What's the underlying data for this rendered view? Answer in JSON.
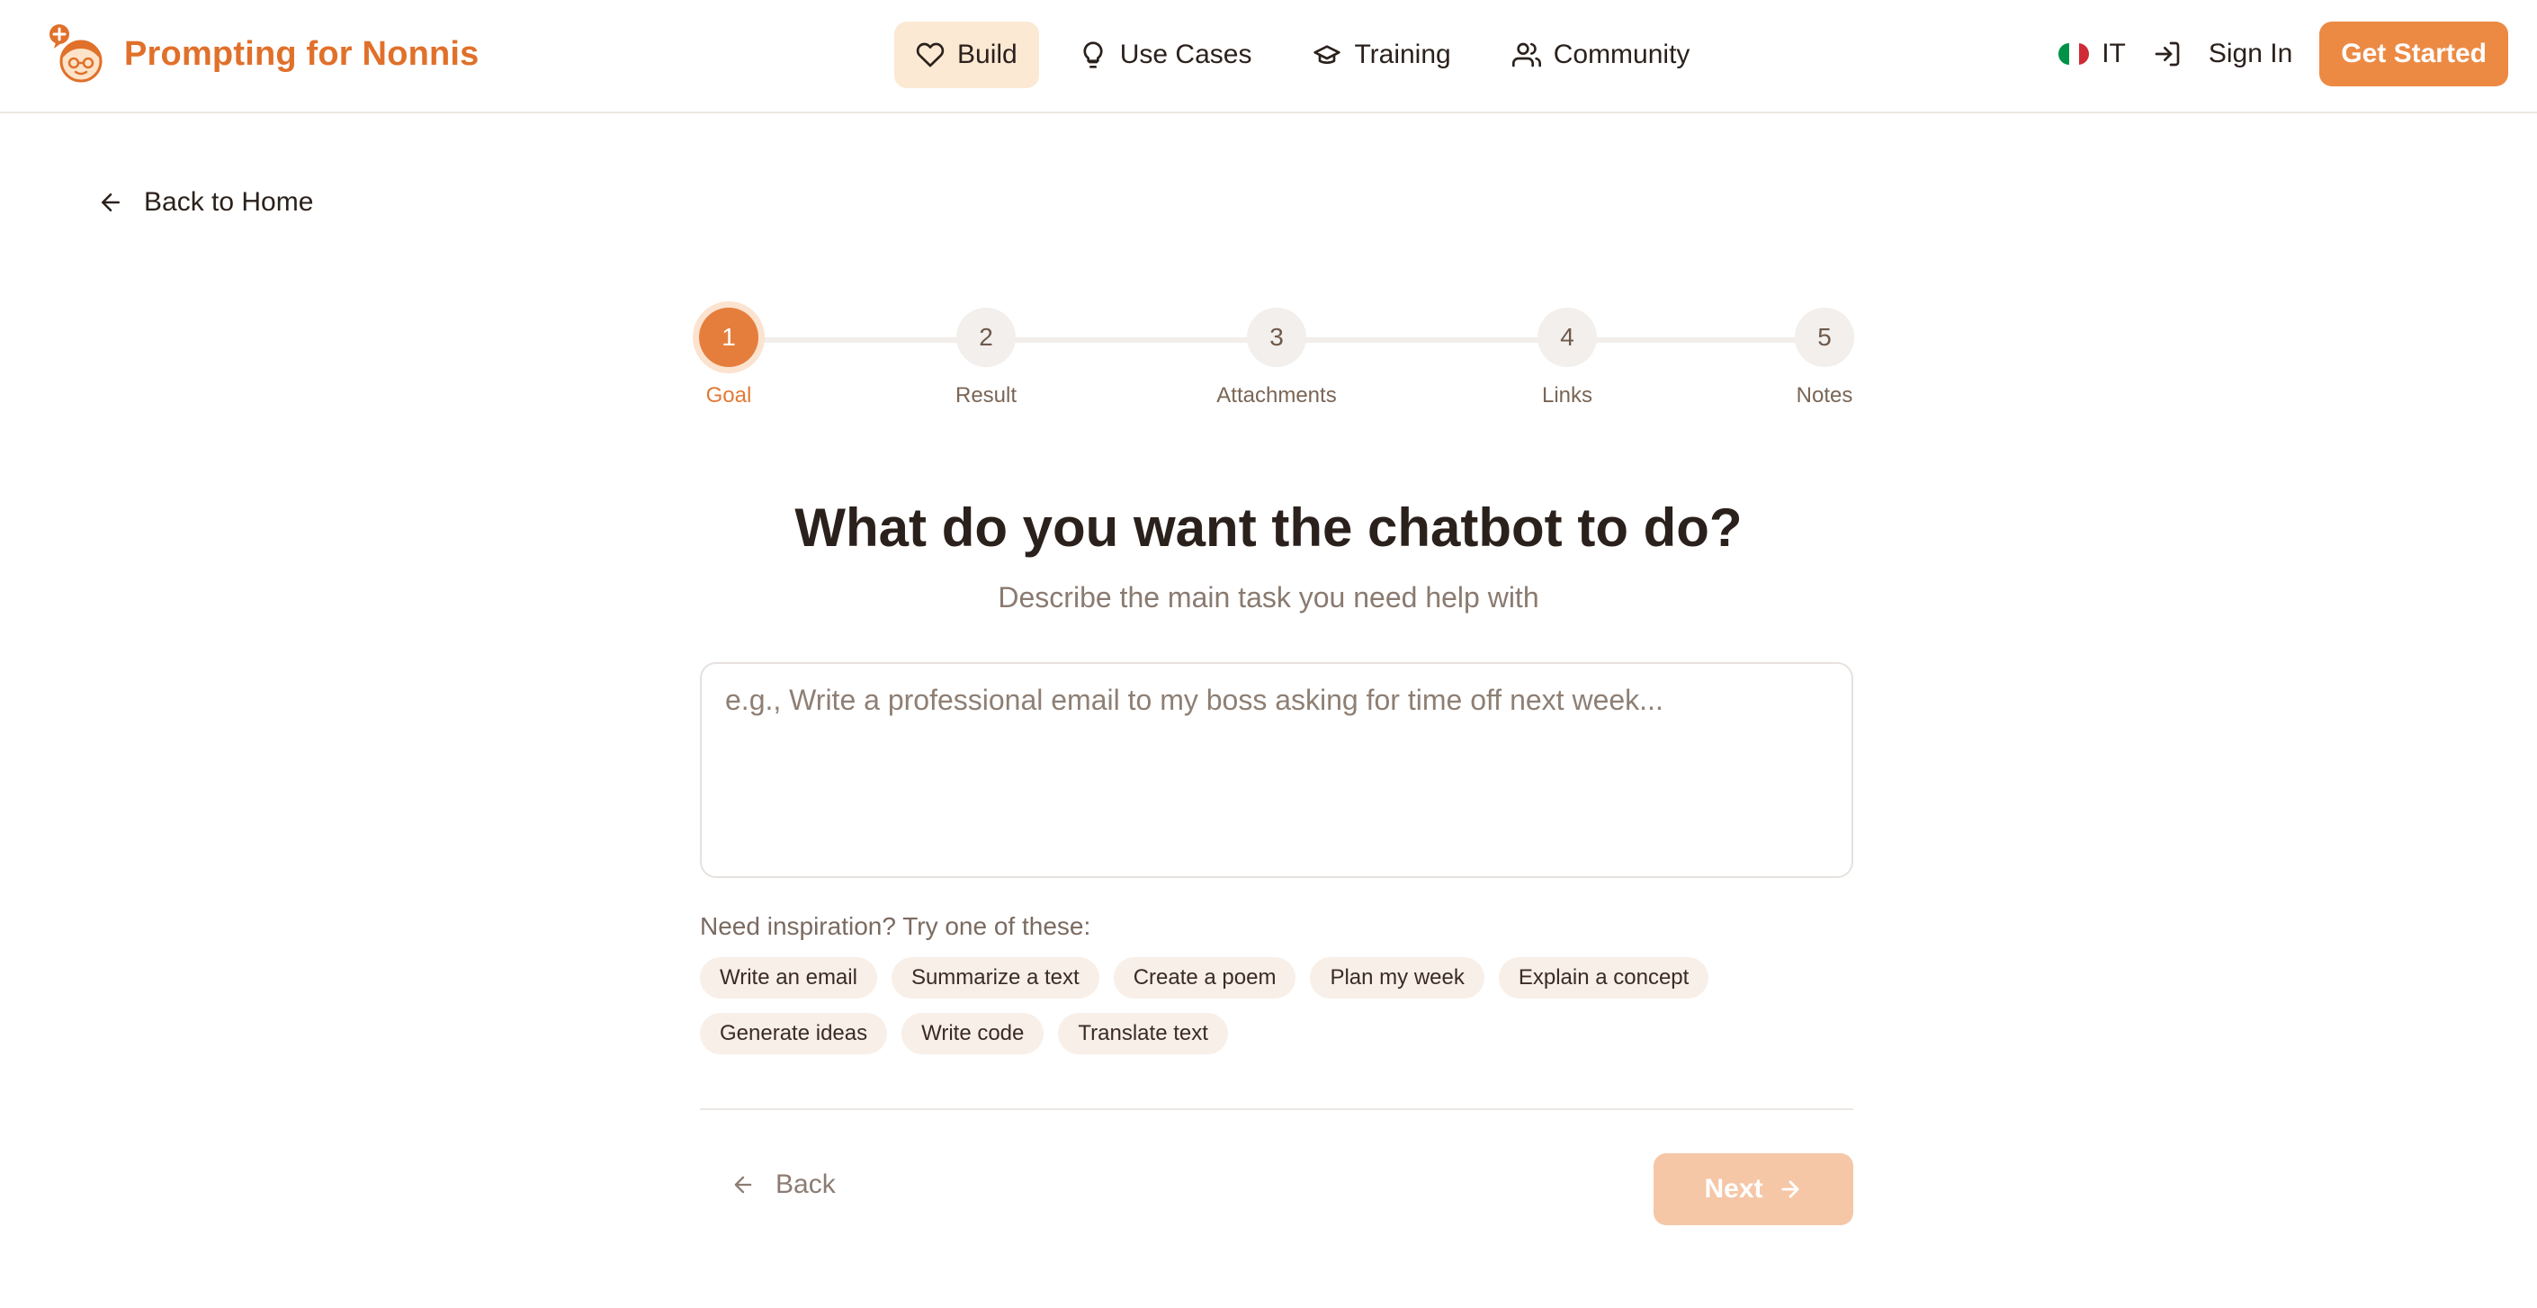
{
  "brand": {
    "name": "Prompting for Nonnis",
    "logo_icon": "grandma-avatar-icon",
    "accent": "#e0702a"
  },
  "nav": {
    "items": [
      {
        "label": "Build",
        "icon": "heart-icon",
        "active": true
      },
      {
        "label": "Use Cases",
        "icon": "lightbulb-icon",
        "active": false
      },
      {
        "label": "Training",
        "icon": "graduation-cap-icon",
        "active": false
      },
      {
        "label": "Community",
        "icon": "users-icon",
        "active": false
      }
    ]
  },
  "header_right": {
    "language": "IT",
    "flag_colors": [
      "#009246",
      "#ffffff",
      "#ce2b37"
    ],
    "signin_label": "Sign In",
    "cta_label": "Get Started",
    "cta_color": "#ec8a44"
  },
  "back_home_label": "Back to Home",
  "stepper": {
    "steps": [
      {
        "number": "1",
        "label": "Goal",
        "active": true
      },
      {
        "number": "2",
        "label": "Result",
        "active": false
      },
      {
        "number": "3",
        "label": "Attachments",
        "active": false
      },
      {
        "number": "4",
        "label": "Links",
        "active": false
      },
      {
        "number": "5",
        "label": "Notes",
        "active": false
      }
    ]
  },
  "question": {
    "title": "What do you want the chatbot to do?",
    "subtitle": "Describe the main task you need help with"
  },
  "goal_input": {
    "value": "",
    "placeholder": "e.g., Write a professional email to my boss asking for time off next week..."
  },
  "inspiration": {
    "label": "Need inspiration? Try one of these:",
    "chips": [
      "Write an email",
      "Summarize a text",
      "Create a poem",
      "Plan my week",
      "Explain a concept",
      "Generate ideas",
      "Write code",
      "Translate text"
    ]
  },
  "footer": {
    "back_label": "Back",
    "next_label": "Next",
    "next_enabled": false
  }
}
